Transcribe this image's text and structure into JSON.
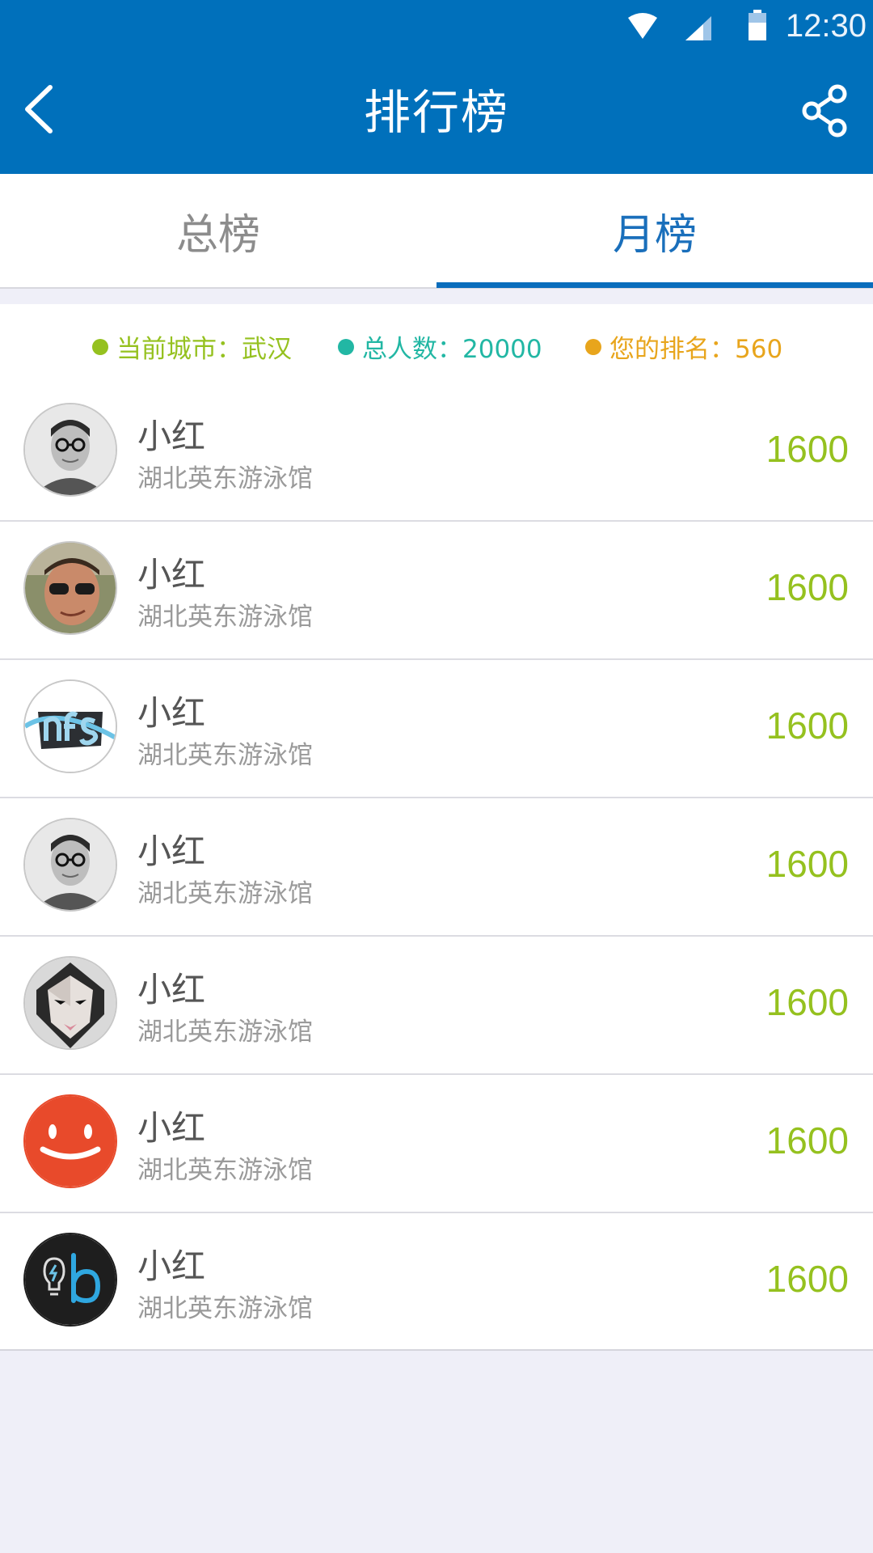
{
  "status_bar": {
    "time": "12:30",
    "icons": [
      "wifi-icon",
      "signal-icon",
      "battery-icon"
    ]
  },
  "app_bar": {
    "title": "排行榜",
    "back_icon": "chevron-left-icon",
    "share_icon": "share-icon"
  },
  "tabs": [
    {
      "label": "总榜",
      "selected": false
    },
    {
      "label": "月榜",
      "selected": true
    }
  ],
  "stats": {
    "city": "当前城市：武汉",
    "total": "总人数：20000",
    "rank": "您的排名：560"
  },
  "ranking": [
    {
      "name": "小红",
      "venue": "湖北英东游泳馆",
      "score": "1600",
      "avatar": "glasses-man-bw"
    },
    {
      "name": "小红",
      "venue": "湖北英东游泳馆",
      "score": "1600",
      "avatar": "sunglasses-man"
    },
    {
      "name": "小红",
      "venue": "湖北英东游泳馆",
      "score": "1600",
      "avatar": "nfs-logo"
    },
    {
      "name": "小红",
      "venue": "湖北英东游泳馆",
      "score": "1600",
      "avatar": "glasses-man-bw"
    },
    {
      "name": "小红",
      "venue": "湖北英东游泳馆",
      "score": "1600",
      "avatar": "polygon-face"
    },
    {
      "name": "小红",
      "venue": "湖北英东游泳馆",
      "score": "1600",
      "avatar": "smile-face"
    },
    {
      "name": "小红",
      "venue": "湖北英东游泳馆",
      "score": "1600",
      "avatar": "bulb-b-logo"
    }
  ],
  "colors": {
    "primary": "#0070bb",
    "accent_green": "#95c11f",
    "accent_teal": "#22b7a4",
    "accent_orange": "#e8a51c"
  }
}
